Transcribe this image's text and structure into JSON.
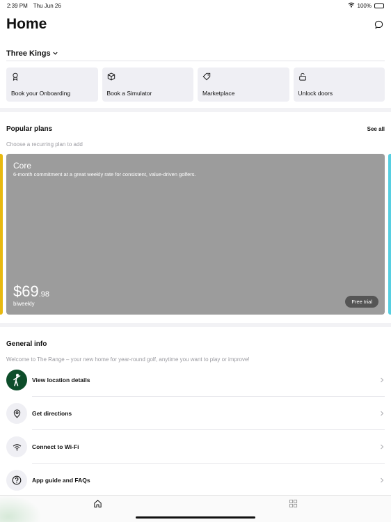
{
  "status_bar": {
    "time": "2:39 PM",
    "date": "Thu Jun 26",
    "battery": "100%",
    "battery_level": 1.0
  },
  "header": {
    "title": "Home"
  },
  "location": {
    "name": "Three Kings"
  },
  "quick_actions": [
    {
      "label": "Book your Onboarding",
      "icon": "award-icon"
    },
    {
      "label": "Book a Simulator",
      "icon": "cube-icon"
    },
    {
      "label": "Marketplace",
      "icon": "tag-icon"
    },
    {
      "label": "Unlock doors",
      "icon": "unlock-icon"
    }
  ],
  "popular_plans": {
    "title": "Popular plans",
    "see_all": "See all",
    "subtitle": "Choose a recurring plan to add",
    "plans": [
      {
        "name": "Core",
        "description": "6-month commitment at a great weekly rate for consistent, value-driven golfers.",
        "price_main": "$69",
        "price_cents": ".98",
        "period": "biweekly",
        "cta": "Free trial"
      }
    ],
    "colors": {
      "card": "#9c9c9c",
      "peek_left": "#e8b90f",
      "peek_right": "#56cfe1"
    }
  },
  "general_info": {
    "title": "General info",
    "subtitle": "Welcome to The Range – your new home for year-round golf, anytime you want to play or improve!",
    "items": [
      {
        "label": "View location details",
        "icon": "golfer-logo-icon"
      },
      {
        "label": "Get directions",
        "icon": "map-pin-icon"
      },
      {
        "label": "Connect to Wi-Fi",
        "icon": "wifi-icon"
      },
      {
        "label": "App guide and FAQs",
        "icon": "help-circle-icon"
      }
    ]
  },
  "tab_bar": {
    "tabs": [
      {
        "icon": "home-icon",
        "active": true
      },
      {
        "icon": "grid-icon",
        "active": false
      }
    ]
  }
}
